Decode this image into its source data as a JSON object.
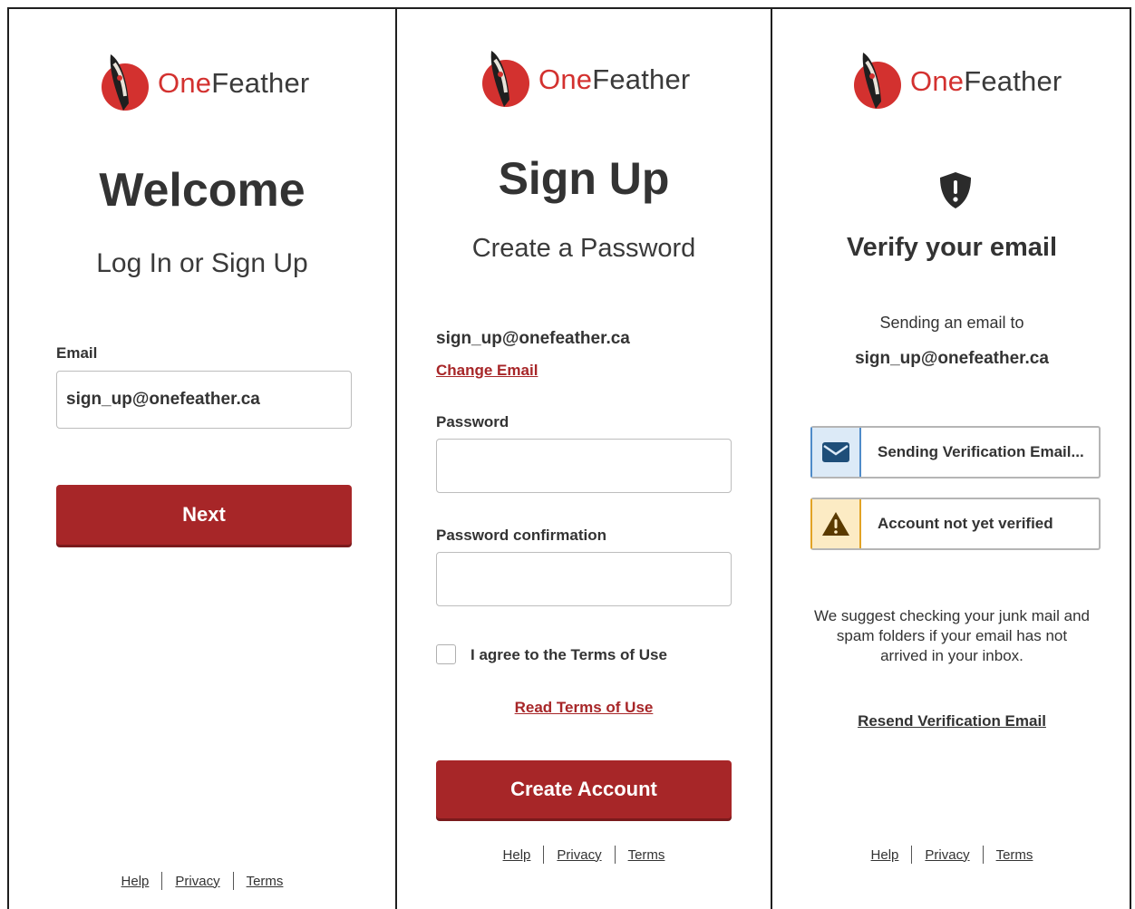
{
  "brand": {
    "one": "One",
    "feather": "Feather"
  },
  "colors": {
    "primary": "#a72628",
    "brand_red": "#d3312f",
    "info_blue": "#4f8bc9",
    "warning_amber": "#e2a324"
  },
  "welcome": {
    "title": "Welcome",
    "subtitle": "Log In or Sign Up",
    "email_label": "Email",
    "email_value": "sign_up@onefeather.ca",
    "next_label": "Next"
  },
  "signup": {
    "title": "Sign Up",
    "subtitle": "Create a Password",
    "email": "sign_up@onefeather.ca",
    "change_email": "Change Email",
    "password_label": "Password",
    "password_confirm_label": "Password confirmation",
    "agree_label": "I agree to the Terms of Use",
    "read_terms": "Read Terms of Use",
    "create_label": "Create Account"
  },
  "verify": {
    "icon": "shield-alert-icon",
    "title": "Verify your email",
    "sending_to": "Sending an email to",
    "email": "sign_up@onefeather.ca",
    "status_sending": "Sending Verification Email...",
    "status_unverified": "Account not yet verified",
    "suggest_line1": "We suggest checking your junk mail and",
    "suggest_line2": "spam folders if your email has not",
    "suggest_line3": "arrived in your inbox.",
    "resend": "Resend Verification Email"
  },
  "footer": {
    "help": "Help",
    "privacy": "Privacy",
    "terms": "Terms"
  }
}
